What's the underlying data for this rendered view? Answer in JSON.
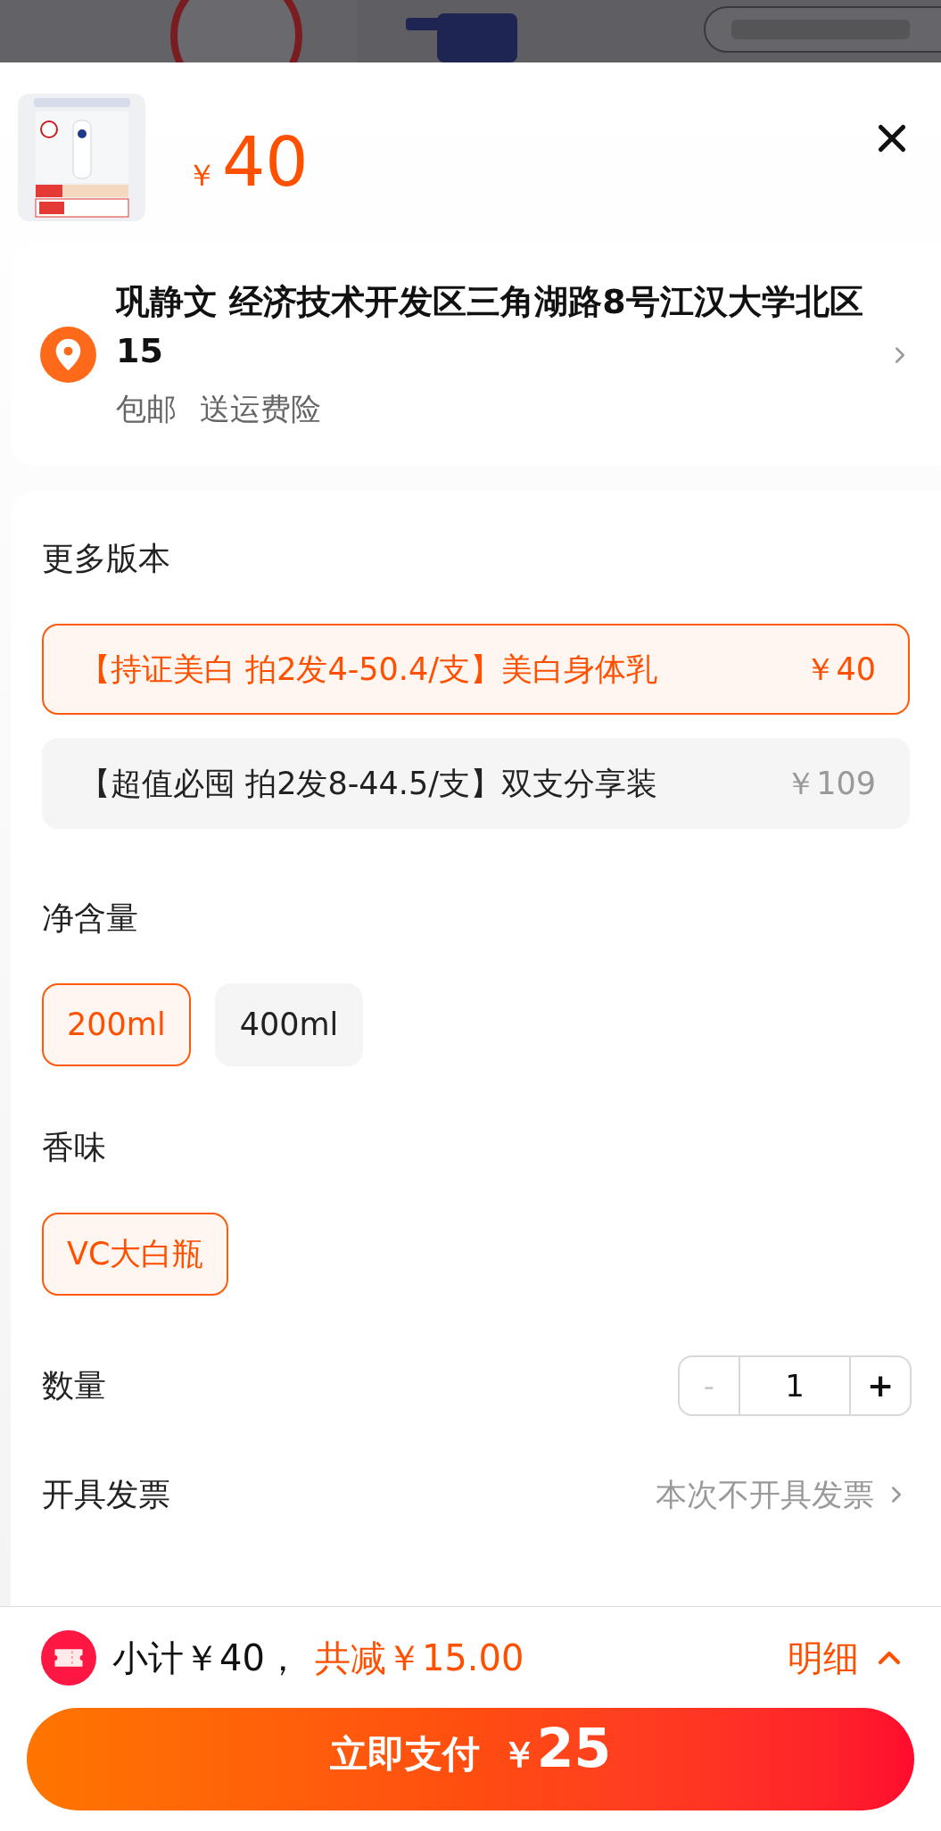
{
  "product": {
    "price_symbol": "￥",
    "price": "40"
  },
  "address": {
    "text": "巩静文 经济技术开发区三角湖路8号江汉大学北区15",
    "tags": [
      "包邮",
      "送运费险"
    ]
  },
  "sections": [
    {
      "kind": "versions",
      "title": "更多版本",
      "options": [
        {
          "label": "【持证美白 拍2发4-50.4/支】美白身体乳",
          "price": "￥40",
          "selected": true
        },
        {
          "label": "【超值必囤 拍2发8-44.5/支】双支分享装",
          "price": "￥109",
          "selected": false
        }
      ]
    },
    {
      "kind": "chips",
      "title": "净含量",
      "options": [
        {
          "label": "200ml",
          "selected": true
        },
        {
          "label": "400ml",
          "selected": false
        }
      ]
    },
    {
      "kind": "chips",
      "title": "香味",
      "options": [
        {
          "label": "VC大白瓶",
          "selected": true
        }
      ]
    },
    {
      "kind": "stepper",
      "title": "数量",
      "minus": "-",
      "value": "1",
      "plus": "+",
      "minus_disabled": true
    },
    {
      "kind": "link",
      "title": "开具发票",
      "value": "本次不开具发票"
    }
  ],
  "summary": {
    "subtotal": "小计￥40，",
    "discount": "共减￥15.00",
    "details": "明细"
  },
  "pay_button": {
    "label": "立即支付",
    "symbol": "￥",
    "amount": "25"
  }
}
